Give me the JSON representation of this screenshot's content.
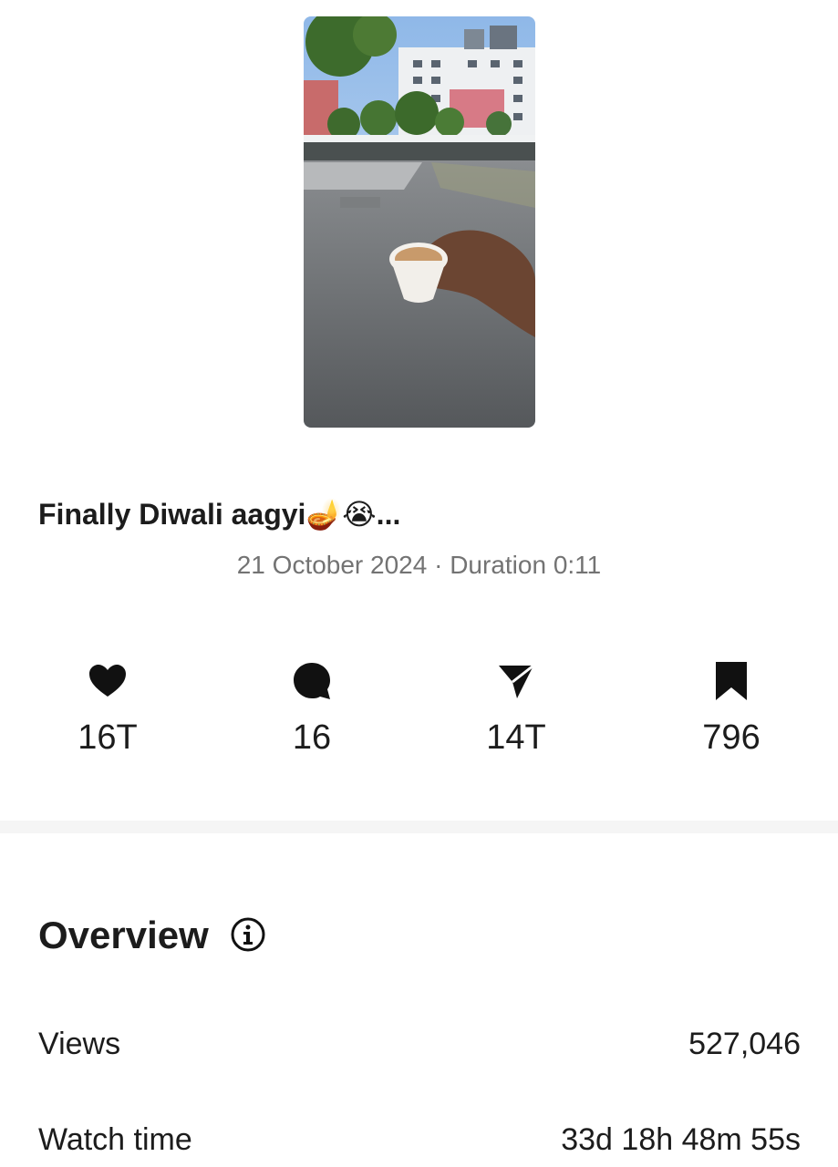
{
  "post": {
    "caption": "Finally Diwali aagyi🪔😭...",
    "meta": "21 October 2024 · Duration 0:11"
  },
  "metrics": [
    {
      "icon": "heart-icon",
      "value": "16T"
    },
    {
      "icon": "comment-icon",
      "value": "16"
    },
    {
      "icon": "share-icon",
      "value": "14T"
    },
    {
      "icon": "bookmark-icon",
      "value": "796"
    }
  ],
  "overview": {
    "title": "Overview",
    "rows": [
      {
        "label": "Views",
        "value": "527,046"
      },
      {
        "label": "Watch time",
        "value": "33d 18h 48m 55s"
      }
    ]
  },
  "colors": {
    "text": "#1c1c1c",
    "secondary_text": "#737373",
    "divider": "#f5f5f5"
  }
}
